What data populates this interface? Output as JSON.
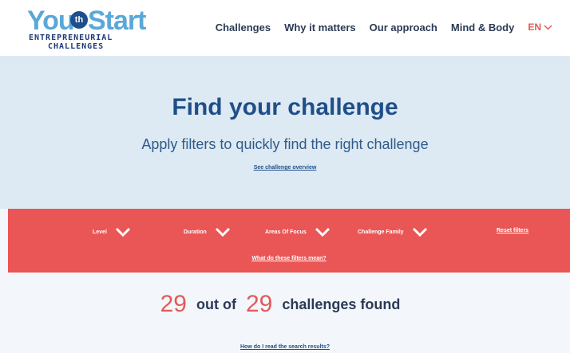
{
  "logo": {
    "you": "You",
    "badge": "th",
    "start": "Start",
    "line1": "ENTREPRENEURIAL",
    "line2": "CHALLENGES"
  },
  "nav": {
    "items": [
      {
        "label": "Challenges"
      },
      {
        "label": "Why it matters"
      },
      {
        "label": "Our approach"
      },
      {
        "label": "Mind & Body"
      }
    ],
    "lang": "EN"
  },
  "hero": {
    "title": "Find your challenge",
    "subtitle": "Apply filters to quickly find the right challenge",
    "overview_link": "See challenge overview"
  },
  "filters": {
    "items": [
      {
        "label": "Level"
      },
      {
        "label": "Duration"
      },
      {
        "label": "Areas Of Focus"
      },
      {
        "label": "Challenge Family"
      }
    ],
    "reset": "Reset filters",
    "help": "What do these filters mean?"
  },
  "results": {
    "found": "29",
    "connector": "out of",
    "total": "29",
    "suffix": "challenges found",
    "help": "How do I read the search results?"
  },
  "colors": {
    "accent_red": "#ea5555",
    "brand_blue": "#1f4f88",
    "hero_bg": "#dde9f3"
  }
}
